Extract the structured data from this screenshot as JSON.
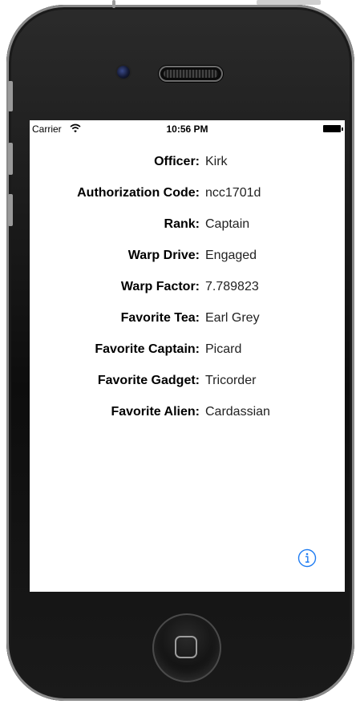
{
  "status_bar": {
    "carrier": "Carrier",
    "time": "10:56 PM"
  },
  "fields": [
    {
      "label": "Officer:",
      "value": "Kirk"
    },
    {
      "label": "Authorization Code:",
      "value": "ncc1701d"
    },
    {
      "label": "Rank:",
      "value": "Captain"
    },
    {
      "label": "Warp Drive:",
      "value": "Engaged"
    },
    {
      "label": "Warp Factor:",
      "value": "7.789823"
    },
    {
      "label": "Favorite Tea:",
      "value": "Earl Grey"
    },
    {
      "label": "Favorite Captain:",
      "value": "Picard"
    },
    {
      "label": "Favorite Gadget:",
      "value": "Tricorder"
    },
    {
      "label": "Favorite Alien:",
      "value": "Cardassian"
    }
  ],
  "icons": {
    "info": "info-icon",
    "wifi": "wifi-icon",
    "battery": "battery-icon"
  },
  "colors": {
    "accent": "#1e7cf2",
    "label": "#000000"
  }
}
